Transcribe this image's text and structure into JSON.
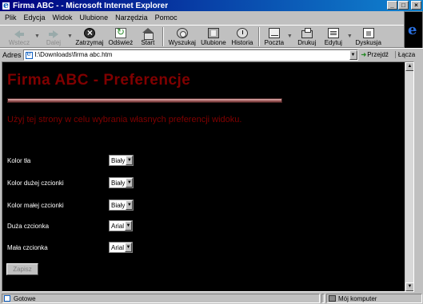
{
  "window": {
    "title": "Firma ABC - - Microsoft Internet Explorer",
    "minimize": "_",
    "maximize": "□",
    "close": "×"
  },
  "menu": {
    "items": [
      {
        "label": "Plik"
      },
      {
        "label": "Edycja"
      },
      {
        "label": "Widok"
      },
      {
        "label": "Ulubione"
      },
      {
        "label": "Narzędzia"
      },
      {
        "label": "Pomoc"
      }
    ]
  },
  "toolbar": {
    "back": "Wstecz",
    "forward": "Dalej",
    "stop": "Zatrzymaj",
    "refresh": "Odśwież",
    "home": "Start",
    "search": "Wyszukaj",
    "favorites": "Ulubione",
    "history": "Historia",
    "mail": "Poczta",
    "print": "Drukuj",
    "edit": "Edytuj",
    "discuss": "Dyskusja"
  },
  "address": {
    "label": "Adres",
    "value": "I:\\Downloads\\firma abc.htm",
    "go": "Przejdź",
    "links": "Łącza"
  },
  "page": {
    "title": "Firma ABC - Preferencje",
    "intro": "Użyj tej strony w celu wybrania własnych preferencji widoku.",
    "fields": [
      {
        "label": "Kolor tła",
        "value": "Biały"
      },
      {
        "label": "Kolor dużej czcionki",
        "value": "Biały"
      },
      {
        "label": "Kolor małej czcionki",
        "value": "Biały"
      },
      {
        "label": "Duża czcionka",
        "value": "Arial"
      },
      {
        "label": "Mała czcionka",
        "value": "Arial"
      }
    ],
    "save": "Zapisz"
  },
  "status": {
    "text": "Gotowe",
    "zone": "Mój komputer"
  },
  "colors": {
    "title_bar": "#000080",
    "page_bg": "#000000",
    "heading": "#800000"
  }
}
